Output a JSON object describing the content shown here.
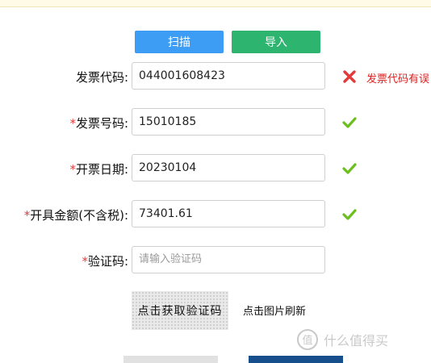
{
  "buttons": {
    "scan": "扫描",
    "import": "导入"
  },
  "fields": [
    {
      "required": false,
      "label": "发票代码:",
      "value": "044001608423",
      "placeholder": "",
      "status": "error",
      "message": "发票代码有误"
    },
    {
      "required": true,
      "label": "发票号码:",
      "value": "15010185",
      "placeholder": "",
      "status": "ok"
    },
    {
      "required": true,
      "label": "开票日期:",
      "value": "20230104",
      "placeholder": "",
      "status": "ok"
    },
    {
      "required": true,
      "label": "开具金额(不含税):",
      "value": "73401.61",
      "placeholder": "",
      "status": "ok"
    },
    {
      "required": true,
      "label": "验证码:",
      "value": "",
      "placeholder": "请输入验证码",
      "status": "none"
    }
  ],
  "required_mark": "*",
  "captcha": {
    "image_text": "点击获取验证码",
    "refresh_text": "点击图片刷新"
  },
  "watermark": {
    "text": "什么值得买",
    "icon": "zhide-logo-icon"
  },
  "colors": {
    "scan": "#3d9df5",
    "import": "#2db46e",
    "error": "#e02020",
    "ok": "#6cbf1f",
    "primary": "#174f8d"
  }
}
